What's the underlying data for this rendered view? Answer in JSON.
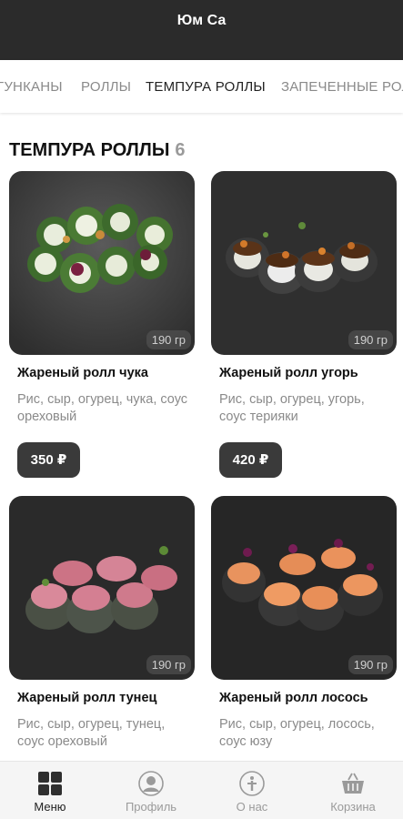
{
  "header": {
    "title": "Юм Са"
  },
  "tabs": [
    {
      "label": "ГУНКАНЫ"
    },
    {
      "label": "РОЛЛЫ"
    },
    {
      "label": "ТЕМПУРА РОЛЛЫ",
      "active": true
    },
    {
      "label": "ЗАПЕЧЕННЫЕ РОЛЛЫ"
    }
  ],
  "section": {
    "title": "ТЕМПУРА РОЛЛЫ",
    "count": "6"
  },
  "products": [
    {
      "name": "Жареный ролл чука",
      "description": "Рис, сыр, огурец, чука, соус ореховый",
      "weight": "190 гр",
      "price": "350 ₽"
    },
    {
      "name": "Жареный ролл угорь",
      "description": "Рис, сыр, огурец, угорь, соус терияки",
      "weight": "190 гр",
      "price": "420 ₽"
    },
    {
      "name": "Жареный ролл тунец",
      "description": "Рис, сыр, огурец, тунец, соус ореховый",
      "weight": "190 гр",
      "price": ""
    },
    {
      "name": "Жареный ролл лосось",
      "description": "Рис, сыр, огурец, лосось, соус юзу",
      "weight": "190 гр",
      "price": ""
    }
  ],
  "bottom_nav": [
    {
      "label": "Меню",
      "icon": "grid-icon",
      "active": true
    },
    {
      "label": "Профиль",
      "icon": "profile-icon"
    },
    {
      "label": "О нас",
      "icon": "info-icon"
    },
    {
      "label": "Корзина",
      "icon": "basket-icon"
    }
  ],
  "colors": {
    "header_bg": "#2b2b2b",
    "price_bg": "#3a3a3a",
    "active_text": "#222222",
    "muted_text": "#8a8a8a"
  }
}
